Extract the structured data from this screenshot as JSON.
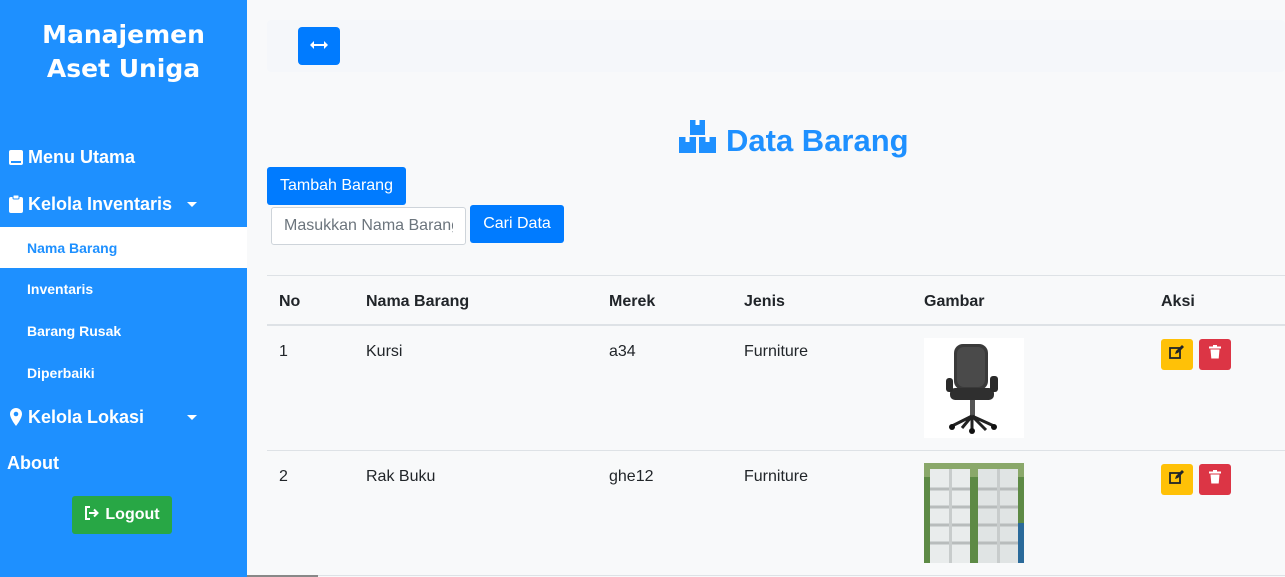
{
  "sidebar": {
    "brand_line1": "Manajemen",
    "brand_line2": "Aset Uniga",
    "menu_utama": "Menu Utama",
    "kelola_inventaris": "Kelola Inventaris",
    "sub_items": [
      "Nama Barang",
      "Inventaris",
      "Barang Rusak",
      "Diperbaiki"
    ],
    "active_item": "Nama Barang",
    "kelola_lokasi": "Kelola Lokasi",
    "about": "About",
    "logout": "Logout"
  },
  "main": {
    "title": "Data Barang",
    "add_button": "Tambah Barang",
    "search_placeholder": "Masukkan Nama Barang",
    "search_button": "Cari Data"
  },
  "table": {
    "headers": [
      "No",
      "Nama Barang",
      "Merek",
      "Jenis",
      "Gambar",
      "Aksi"
    ],
    "rows": [
      {
        "no": "1",
        "nama": "Kursi",
        "merek": "a34",
        "jenis": "Furniture",
        "gambar": "office-chair"
      },
      {
        "no": "2",
        "nama": "Rak Buku",
        "merek": "ghe12",
        "jenis": "Furniture",
        "gambar": "bookshelf"
      }
    ]
  },
  "colors": {
    "sidebar": "#1e90ff",
    "primary": "#007bff",
    "success": "#28a745",
    "warning": "#ffc107",
    "danger": "#dc3545"
  }
}
